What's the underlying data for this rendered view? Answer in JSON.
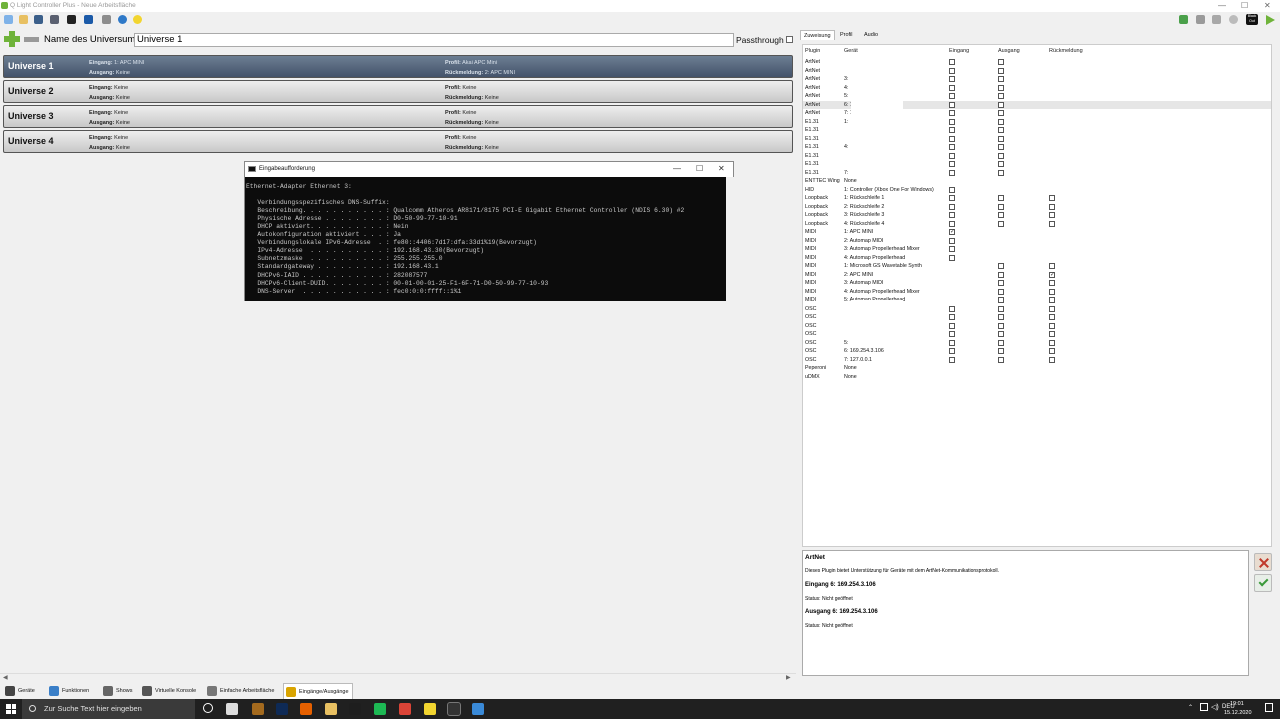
{
  "window": {
    "title": "Q Light Controller Plus - Neue Arbeitsfläche"
  },
  "colors": {
    "accent_green": "#6fb33a",
    "selected_row": "#4d5d73",
    "cmd_bg": "#0c0c0c",
    "taskbar": "#202020"
  },
  "toolbar": {
    "icons": [
      "new-icon",
      "open-icon",
      "save-icon",
      "save-as-icon",
      "fixture-icon",
      "fullscreen-icon",
      "control-monitor-icon",
      "help-icon",
      "about-icon"
    ],
    "right_icons": [
      "add-fixture-icon",
      "blackout-icon",
      "live-edit-icon",
      "stop-icon",
      "blackout-out-icon",
      "play-icon"
    ],
    "blackout_label": "Black Out"
  },
  "universe_header": {
    "name_label": "Name des Universums:",
    "name_value": "Universe 1",
    "passthrough_label": "Passthrough"
  },
  "universes": [
    {
      "name": "Universe 1",
      "input_label": "Eingang:",
      "input": "1: APC MINI",
      "output_label": "Ausgang:",
      "output": "Keine",
      "profile_label": "Profil:",
      "profile": "Akai APC Mini",
      "feedback_label": "Rückmeldung:",
      "feedback": "2: APC MINI",
      "selected": true
    },
    {
      "name": "Universe 2",
      "input_label": "Eingang:",
      "input": "Keine",
      "output_label": "Ausgang:",
      "output": "Keine",
      "profile_label": "Profil:",
      "profile": "Keine",
      "feedback_label": "Rückmeldung:",
      "feedback": "Keine",
      "selected": false
    },
    {
      "name": "Universe 3",
      "input_label": "Eingang:",
      "input": "Keine",
      "output_label": "Ausgang:",
      "output": "Keine",
      "profile_label": "Profil:",
      "profile": "Keine",
      "feedback_label": "Rückmeldung:",
      "feedback": "Keine",
      "selected": false
    },
    {
      "name": "Universe 4",
      "input_label": "Eingang:",
      "input": "Keine",
      "output_label": "Ausgang:",
      "output": "Keine",
      "profile_label": "Profil:",
      "profile": "Keine",
      "feedback_label": "Rückmeldung:",
      "feedback": "Keine",
      "selected": false
    }
  ],
  "cmd": {
    "title": "Eingabeaufforderung",
    "lines": [
      "Ethernet-Adapter Ethernet 3:",
      "",
      "   Verbindungsspezifisches DNS-Suffix:",
      "   Beschreibung. . . . . . . . . . . : Qualcomm Atheros AR8171/8175 PCI-E Gigabit Ethernet Controller (NDIS 6.30) #2",
      "   Physische Adresse . . . . . . . . : D0-50-99-77-10-91",
      "   DHCP aktiviert. . . . . . . . . . : Nein",
      "   Autokonfiguration aktiviert . . . : Ja",
      "   Verbindungslokale IPv6-Adresse  . : fe80::4406:7d17:dfa:33d1%19(Bevorzugt)",
      "   IPv4-Adresse  . . . . . . . . . . : 192.168.43.30(Bevorzugt)",
      "   Subnetzmaske  . . . . . . . . . . : 255.255.255.0",
      "   Standardgateway . . . . . . . . . : 192.168.43.1",
      "   DHCPv6-IAID . . . . . . . . . . . : 282087577",
      "   DHCPv6-Client-DUID. . . . . . . . : 00-01-00-01-25-F1-6F-71-D0-50-99-77-10-93",
      "   DNS-Server  . . . . . . . . . . . : fec0:0:0:ffff::1%1"
    ]
  },
  "bottom_tabs": [
    {
      "label": "Geräte",
      "icon": "fixture-icon",
      "color": "#444"
    },
    {
      "label": "Funktionen",
      "icon": "functions-icon",
      "color": "#3a7fc8"
    },
    {
      "label": "Shows",
      "icon": "shows-icon",
      "color": "#666"
    },
    {
      "label": "Virtuelle Konsole",
      "icon": "virtual-console-icon",
      "color": "#555"
    },
    {
      "label": "Einfache Arbeitsfläche",
      "icon": "simple-desk-icon",
      "color": "#777"
    },
    {
      "label": "Eingänge/Ausgänge",
      "icon": "io-icon",
      "color": "#d9a400"
    }
  ],
  "right_tabs": [
    "Zuweisung",
    "Profil",
    "Audio"
  ],
  "plugin_table": {
    "headers": [
      "Plugin",
      "Gerät",
      "Eingang",
      "Ausgang",
      "Rückmeldung"
    ],
    "rows": [
      {
        "plugin": "ArtNet",
        "device": "",
        "in": true,
        "out": true,
        "fb": false,
        "in_c": false,
        "out_c": false,
        "fb_c": false
      },
      {
        "plugin": "ArtNet",
        "device": "",
        "in": true,
        "out": true,
        "fb": false,
        "in_c": false,
        "out_c": false,
        "fb_c": false
      },
      {
        "plugin": "ArtNet",
        "device": "3:",
        "in": true,
        "out": true,
        "fb": false,
        "in_c": false,
        "out_c": false,
        "fb_c": false
      },
      {
        "plugin": "ArtNet",
        "device": "4:",
        "in": true,
        "out": true,
        "fb": false,
        "in_c": false,
        "out_c": false,
        "fb_c": false
      },
      {
        "plugin": "ArtNet",
        "device": "5:",
        "in": true,
        "out": true,
        "fb": false,
        "in_c": false,
        "out_c": false,
        "fb_c": false
      },
      {
        "plugin": "ArtNet",
        "device": "6: 169.254.3.106",
        "in": true,
        "out": true,
        "fb": false,
        "in_c": false,
        "out_c": false,
        "fb_c": false,
        "hl": true
      },
      {
        "plugin": "ArtNet",
        "device": "7: 127.0.0.1",
        "in": true,
        "out": true,
        "fb": false,
        "in_c": false,
        "out_c": false,
        "fb_c": false
      },
      {
        "plugin": "E1.31",
        "device": "1:",
        "in": true,
        "out": true,
        "fb": false,
        "in_c": false,
        "out_c": false,
        "fb_c": false
      },
      {
        "plugin": "E1.31",
        "device": "",
        "in": true,
        "out": true,
        "fb": false,
        "in_c": false,
        "out_c": false,
        "fb_c": false
      },
      {
        "plugin": "E1.31",
        "device": "",
        "in": true,
        "out": true,
        "fb": false,
        "in_c": false,
        "out_c": false,
        "fb_c": false
      },
      {
        "plugin": "E1.31",
        "device": "4:",
        "in": true,
        "out": true,
        "fb": false,
        "in_c": false,
        "out_c": false,
        "fb_c": false
      },
      {
        "plugin": "E1.31",
        "device": "",
        "in": true,
        "out": true,
        "fb": false,
        "in_c": false,
        "out_c": false,
        "fb_c": false
      },
      {
        "plugin": "E1.31",
        "device": "",
        "in": true,
        "out": true,
        "fb": false,
        "in_c": false,
        "out_c": false,
        "fb_c": false
      },
      {
        "plugin": "E1.31",
        "device": "7:",
        "in": true,
        "out": true,
        "fb": false,
        "in_c": false,
        "out_c": false,
        "fb_c": false
      },
      {
        "plugin": "ENTTEC Wing",
        "device": "None",
        "in": false,
        "out": false,
        "fb": false,
        "in_c": false,
        "out_c": false,
        "fb_c": false
      },
      {
        "plugin": "HID",
        "device": "1: Controller (Xbox One For Windows)",
        "in": true,
        "out": false,
        "fb": false,
        "in_c": false,
        "out_c": false,
        "fb_c": false
      },
      {
        "plugin": "Loopback",
        "device": "1: Rückschleife 1",
        "in": true,
        "out": true,
        "fb": true,
        "in_c": false,
        "out_c": false,
        "fb_c": false
      },
      {
        "plugin": "Loopback",
        "device": "2: Rückschleife 2",
        "in": true,
        "out": true,
        "fb": true,
        "in_c": false,
        "out_c": false,
        "fb_c": false
      },
      {
        "plugin": "Loopback",
        "device": "3: Rückschleife 3",
        "in": true,
        "out": true,
        "fb": true,
        "in_c": false,
        "out_c": false,
        "fb_c": false
      },
      {
        "plugin": "Loopback",
        "device": "4: Rückschleife 4",
        "in": true,
        "out": true,
        "fb": true,
        "in_c": false,
        "out_c": false,
        "fb_c": false
      },
      {
        "plugin": "MIDI",
        "device": "1: APC MINI",
        "in": true,
        "out": false,
        "fb": false,
        "in_c": true,
        "out_c": false,
        "fb_c": false
      },
      {
        "plugin": "MIDI",
        "device": "2: Automap MIDI",
        "in": true,
        "out": false,
        "fb": false,
        "in_c": false,
        "out_c": false,
        "fb_c": false
      },
      {
        "plugin": "MIDI",
        "device": "3: Automap Propellerhead Mixer",
        "in": true,
        "out": false,
        "fb": false,
        "in_c": false,
        "out_c": false,
        "fb_c": false
      },
      {
        "plugin": "MIDI",
        "device": "4: Automap Propellerhead",
        "in": true,
        "out": false,
        "fb": false,
        "in_c": false,
        "out_c": false,
        "fb_c": false
      },
      {
        "plugin": "MIDI",
        "device": "1: Microsoft GS Wavetable Synth",
        "in": false,
        "out": true,
        "fb": true,
        "in_c": false,
        "out_c": false,
        "fb_c": false
      },
      {
        "plugin": "MIDI",
        "device": "2: APC MINI",
        "in": false,
        "out": true,
        "fb": true,
        "in_c": false,
        "out_c": false,
        "fb_c": true
      },
      {
        "plugin": "MIDI",
        "device": "3: Automap MIDI",
        "in": false,
        "out": true,
        "fb": true,
        "in_c": false,
        "out_c": false,
        "fb_c": false
      },
      {
        "plugin": "MIDI",
        "device": "4: Automap Propellerhead Mixer",
        "in": false,
        "out": true,
        "fb": true,
        "in_c": false,
        "out_c": false,
        "fb_c": false
      },
      {
        "plugin": "MIDI",
        "device": "5: Automap Propellerhead",
        "in": false,
        "out": true,
        "fb": true,
        "in_c": false,
        "out_c": false,
        "fb_c": false
      },
      {
        "plugin": "OSC",
        "device": "",
        "in": true,
        "out": true,
        "fb": true,
        "in_c": false,
        "out_c": false,
        "fb_c": false
      },
      {
        "plugin": "OSC",
        "device": "",
        "in": true,
        "out": true,
        "fb": true,
        "in_c": false,
        "out_c": false,
        "fb_c": false
      },
      {
        "plugin": "OSC",
        "device": "",
        "in": true,
        "out": true,
        "fb": true,
        "in_c": false,
        "out_c": false,
        "fb_c": false
      },
      {
        "plugin": "OSC",
        "device": "",
        "in": true,
        "out": true,
        "fb": true,
        "in_c": false,
        "out_c": false,
        "fb_c": false
      },
      {
        "plugin": "OSC",
        "device": "5:",
        "in": true,
        "out": true,
        "fb": true,
        "in_c": false,
        "out_c": false,
        "fb_c": false
      },
      {
        "plugin": "OSC",
        "device": "6: 169.254.3.106",
        "in": true,
        "out": true,
        "fb": true,
        "in_c": false,
        "out_c": false,
        "fb_c": false
      },
      {
        "plugin": "OSC",
        "device": "7: 127.0.0.1",
        "in": true,
        "out": true,
        "fb": true,
        "in_c": false,
        "out_c": false,
        "fb_c": false
      },
      {
        "plugin": "Peperoni",
        "device": "None",
        "in": false,
        "out": false,
        "fb": false,
        "in_c": false,
        "out_c": false,
        "fb_c": false
      },
      {
        "plugin": "uDMX",
        "device": "None",
        "in": false,
        "out": false,
        "fb": false,
        "in_c": false,
        "out_c": false,
        "fb_c": false
      }
    ]
  },
  "info": {
    "title": "ArtNet",
    "description": "Dieses Plugin bietet Unterstützung für Geräte mit dem ArtNet-Kommunikationsprotokoll.",
    "input_heading": "Eingang 6: 169.254.3.106",
    "input_status": "Status: Nicht geöffnet",
    "output_heading": "Ausgang 6: 169.254.3.106",
    "output_status": "Status: Nicht geöffnet"
  },
  "side_buttons": [
    "configure-icon",
    "check-icon"
  ],
  "taskbar": {
    "search_placeholder": "Zur Suche Text hier eingeben",
    "time": "19:01",
    "date": "15.12.2020",
    "apps": [
      "cortana-icon",
      "task-view-icon",
      "bridge-icon",
      "photoshop-icon",
      "firefox-icon",
      "file-explorer-icon",
      "inkscape-icon",
      "spotify-icon",
      "chrome-icon",
      "norton-icon",
      "cmd-icon",
      "qlc-icon"
    ]
  }
}
